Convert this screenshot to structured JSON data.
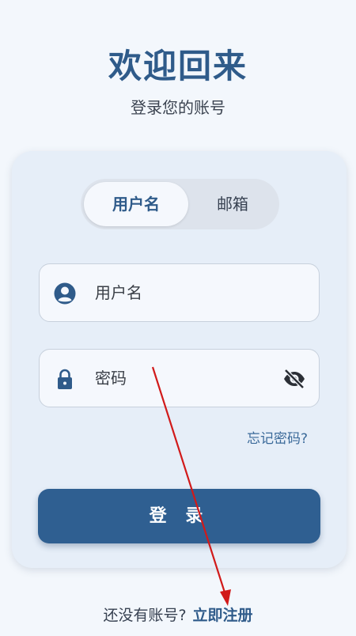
{
  "header": {
    "title": "欢迎回来",
    "subtitle": "登录您的账号"
  },
  "tabs": [
    {
      "label": "用户名",
      "active": true
    },
    {
      "label": "邮箱",
      "active": false
    }
  ],
  "username_field": {
    "placeholder": "用户名",
    "icon": "user-icon"
  },
  "password_field": {
    "placeholder": "密码",
    "icon": "lock-icon",
    "toggle_icon": "eye-off-icon"
  },
  "forgot_link": "忘记密码?",
  "login_button": "登 录",
  "footer": {
    "question": "还没有账号?",
    "register_link": "立即注册"
  },
  "colors": {
    "primary": "#2f5b8a",
    "card": "#e6eef8",
    "annotation_arrow": "#d11a1a"
  }
}
